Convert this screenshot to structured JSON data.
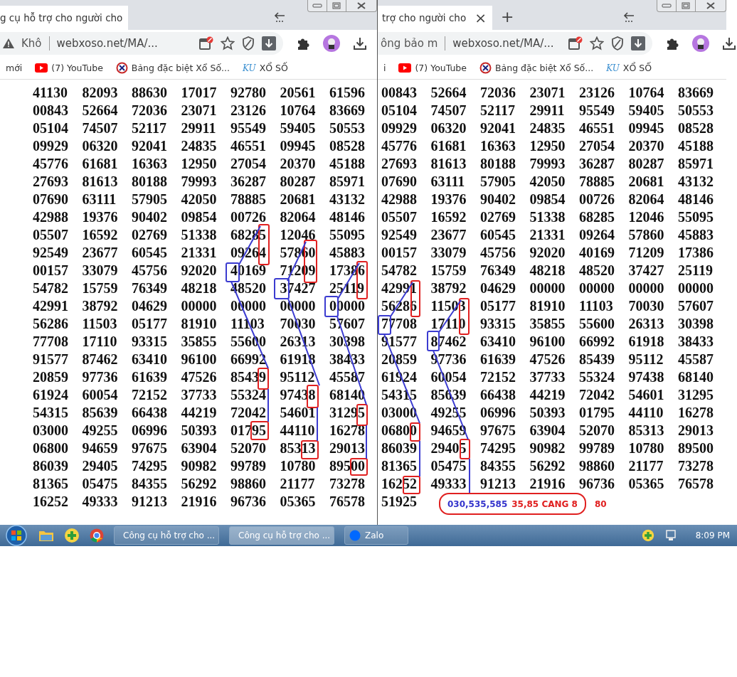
{
  "windows": [
    {
      "tab_title": "g cụ hỗ trợ cho người cho",
      "security_text": "Khô",
      "url": "webxoso.net/MA/...",
      "bookmarks": [
        {
          "kind": "text",
          "label": "mới"
        },
        {
          "kind": "youtube",
          "label": "(7) YouTube"
        },
        {
          "kind": "xoso",
          "label": "Bảng đặc biệt Xổ Số..."
        },
        {
          "kind": "ku",
          "logo": "KU",
          "label": "XỔ SỐ"
        }
      ],
      "rows": [
        [
          "41130",
          "82093",
          "88630",
          "17017",
          "92780",
          "20561",
          "61596"
        ],
        [
          "00843",
          "52664",
          "72036",
          "23071",
          "23126",
          "10764",
          "83669"
        ],
        [
          "05104",
          "74507",
          "52117",
          "29911",
          "95549",
          "59405",
          "50553"
        ],
        [
          "09929",
          "06320",
          "92041",
          "24835",
          "46551",
          "09945",
          "08528"
        ],
        [
          "45776",
          "61681",
          "16363",
          "12950",
          "27054",
          "20370",
          "45188"
        ],
        [
          "27693",
          "81613",
          "80188",
          "79993",
          "36287",
          "80287",
          "85971"
        ],
        [
          "07690",
          "63111",
          "57905",
          "42050",
          "78885",
          "20681",
          "43132"
        ],
        [
          "42988",
          "19376",
          "90402",
          "09854",
          "00726",
          "82064",
          "48146"
        ],
        [
          "05507",
          "16592",
          "02769",
          "51338",
          "68285",
          "12046",
          "55095"
        ],
        [
          "92549",
          "23677",
          "60545",
          "21331",
          "09264",
          "57860",
          "45883"
        ],
        [
          "00157",
          "33079",
          "45756",
          "92020",
          "40169",
          "71209",
          "17386"
        ],
        [
          "54782",
          "15759",
          "76349",
          "48218",
          "48520",
          "37427",
          "25119"
        ],
        [
          "42991",
          "38792",
          "04629",
          "00000",
          "00000",
          "00000",
          "00000"
        ],
        [
          "56286",
          "11503",
          "05177",
          "81910",
          "11103",
          "70030",
          "57607"
        ],
        [
          "77708",
          "17110",
          "93315",
          "35855",
          "55600",
          "26313",
          "30398"
        ],
        [
          "91577",
          "87462",
          "63410",
          "96100",
          "66992",
          "61918",
          "38433"
        ],
        [
          "20859",
          "97736",
          "61639",
          "47526",
          "85439",
          "95112",
          "45587"
        ],
        [
          "61924",
          "60054",
          "72152",
          "37733",
          "55324",
          "97438",
          "68140"
        ],
        [
          "54315",
          "85639",
          "66438",
          "44219",
          "72042",
          "54601",
          "31295"
        ],
        [
          "03000",
          "49255",
          "06996",
          "50393",
          "01795",
          "44110",
          "16278"
        ],
        [
          "06800",
          "94659",
          "97675",
          "63904",
          "52070",
          "85313",
          "29013"
        ],
        [
          "86039",
          "29405",
          "74295",
          "90982",
          "99789",
          "10780",
          "89500"
        ],
        [
          "81365",
          "05475",
          "84355",
          "56292",
          "98860",
          "21177",
          "73278"
        ],
        [
          "16252",
          "49333",
          "91213",
          "21916",
          "96736",
          "05365",
          "76578"
        ]
      ]
    },
    {
      "tab_title": "trợ cho người cho",
      "tab_close": "×",
      "new_tab": "+",
      "security_text": "ông bảo m",
      "url": "webxoso.net/MA/...",
      "bookmarks": [
        {
          "kind": "text",
          "label": "i"
        },
        {
          "kind": "youtube",
          "label": "(7) YouTube"
        },
        {
          "kind": "xoso",
          "label": "Bảng đặc biệt Xổ Số..."
        },
        {
          "kind": "ku",
          "logo": "KU",
          "label": "XỔ SỐ"
        }
      ],
      "rows": [
        [
          "00843",
          "52664",
          "72036",
          "23071",
          "23126",
          "10764",
          "83669"
        ],
        [
          "05104",
          "74507",
          "52117",
          "29911",
          "95549",
          "59405",
          "50553"
        ],
        [
          "09929",
          "06320",
          "92041",
          "24835",
          "46551",
          "09945",
          "08528"
        ],
        [
          "45776",
          "61681",
          "16363",
          "12950",
          "27054",
          "20370",
          "45188"
        ],
        [
          "27693",
          "81613",
          "80188",
          "79993",
          "36287",
          "80287",
          "85971"
        ],
        [
          "07690",
          "63111",
          "57905",
          "42050",
          "78885",
          "20681",
          "43132"
        ],
        [
          "42988",
          "19376",
          "90402",
          "09854",
          "00726",
          "82064",
          "48146"
        ],
        [
          "05507",
          "16592",
          "02769",
          "51338",
          "68285",
          "12046",
          "55095"
        ],
        [
          "92549",
          "23677",
          "60545",
          "21331",
          "09264",
          "57860",
          "45883"
        ],
        [
          "00157",
          "33079",
          "45756",
          "92020",
          "40169",
          "71209",
          "17386"
        ],
        [
          "54782",
          "15759",
          "76349",
          "48218",
          "48520",
          "37427",
          "25119"
        ],
        [
          "42991",
          "38792",
          "04629",
          "00000",
          "00000",
          "00000",
          "00000"
        ],
        [
          "56286",
          "11503",
          "05177",
          "81910",
          "11103",
          "70030",
          "57607"
        ],
        [
          "77708",
          "17110",
          "93315",
          "35855",
          "55600",
          "26313",
          "30398"
        ],
        [
          "91577",
          "87462",
          "63410",
          "96100",
          "66992",
          "61918",
          "38433"
        ],
        [
          "20859",
          "97736",
          "61639",
          "47526",
          "85439",
          "95112",
          "45587"
        ],
        [
          "61924",
          "60054",
          "72152",
          "37733",
          "55324",
          "97438",
          "68140"
        ],
        [
          "54315",
          "85639",
          "66438",
          "44219",
          "72042",
          "54601",
          "31295"
        ],
        [
          "03000",
          "49255",
          "06996",
          "50393",
          "01795",
          "44110",
          "16278"
        ],
        [
          "06800",
          "94659",
          "97675",
          "63904",
          "52070",
          "85313",
          "29013"
        ],
        [
          "86039",
          "29405",
          "74295",
          "90982",
          "99789",
          "10780",
          "89500"
        ],
        [
          "81365",
          "05475",
          "84355",
          "56292",
          "98860",
          "21177",
          "73278"
        ],
        [
          "16252",
          "49333",
          "91213",
          "21916",
          "96736",
          "05365",
          "76578"
        ],
        [
          "51925"
        ]
      ]
    }
  ],
  "annotation": {
    "parts": [
      {
        "text": "030,535,585",
        "color": "#3333cc"
      },
      {
        "text": "35,85 CANG 8",
        "color": "#e02020"
      }
    ],
    "note": "80"
  },
  "taskbar": {
    "buttons": [
      {
        "label": "Công cụ hỗ trợ cho ...",
        "selected": false
      },
      {
        "label": "Công cụ hỗ trợ cho ...",
        "selected": true
      }
    ],
    "zalo": "Zalo",
    "clock": "8:09 PM"
  }
}
